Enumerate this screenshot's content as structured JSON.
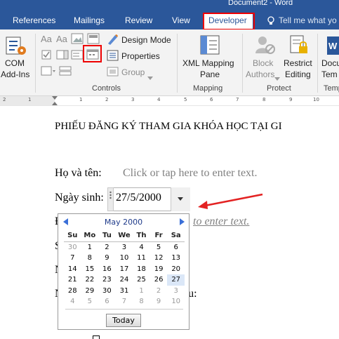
{
  "window": {
    "title": "Document2 - Word"
  },
  "tabs": {
    "references": "References",
    "mailings": "Mailings",
    "review": "Review",
    "view": "View",
    "developer": "Developer",
    "tell_me": "Tell me what yo"
  },
  "ribbon": {
    "com_addins_line1": "COM",
    "com_addins_line2": "Add-Ins",
    "design_mode": "Design Mode",
    "properties": "Properties",
    "group": "Group",
    "controls_label": "Controls",
    "xml_pane_line1": "XML Mapping",
    "xml_pane_line2": "Pane",
    "mapping_label": "Mapping",
    "block_line1": "Block",
    "block_line2": "Authors",
    "restrict_line1": "Restrict",
    "restrict_line2": "Editing",
    "protect_label": "Protect",
    "docu_line1": "Docu",
    "docu_line2": "Tem",
    "templates_label": "Temp"
  },
  "ruler": {
    "ticks": [
      "2",
      "1",
      "1",
      "2",
      "3",
      "4",
      "5",
      "6",
      "7",
      "8",
      "9",
      "10"
    ]
  },
  "document": {
    "heading": "PHIẾU ĐĂNG KÝ THAM GIA KHÓA HỌC TẠI GI",
    "name_label": "Họ và tên:",
    "name_placeholder": "Click or tap here to enter text.",
    "dob_label": "Ngày sinh:",
    "dob_value": "27/5/2000",
    "partial_placeholder": "to enter text.",
    "partial_line3": "S",
    "partial_line4": "N",
    "partial_line5_start": "N",
    "partial_line5_end": "ầu:"
  },
  "calendar": {
    "month": "May 2000",
    "weekdays": [
      "Su",
      "Mo",
      "Tu",
      "We",
      "Th",
      "Fr",
      "Sa"
    ],
    "weeks": [
      [
        "30",
        "1",
        "2",
        "3",
        "4",
        "5",
        "6"
      ],
      [
        "7",
        "8",
        "9",
        "10",
        "11",
        "12",
        "13"
      ],
      [
        "14",
        "15",
        "16",
        "17",
        "18",
        "19",
        "20"
      ],
      [
        "21",
        "22",
        "23",
        "24",
        "25",
        "26",
        "27"
      ],
      [
        "28",
        "29",
        "30",
        "31",
        "1",
        "2",
        "3"
      ],
      [
        "4",
        "5",
        "6",
        "7",
        "8",
        "9",
        "10"
      ]
    ],
    "today_label": "Today"
  },
  "colors": {
    "title_bar": "#2b579a",
    "highlight_red": "#e00000",
    "placeholder_gray": "#808080",
    "selected_day": "#dbe7f7"
  }
}
